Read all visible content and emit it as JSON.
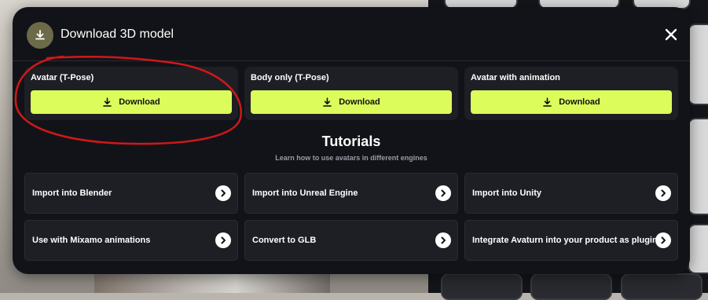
{
  "modal": {
    "title": "Download 3D model",
    "icon": "download-icon",
    "close_icon": "close-icon"
  },
  "downloads": [
    {
      "label": "Avatar (T-Pose)",
      "button": "Download"
    },
    {
      "label": "Body only (T-Pose)",
      "button": "Download"
    },
    {
      "label": "Avatar with animation",
      "button": "Download"
    }
  ],
  "tutorials": {
    "title": "Tutorials",
    "subtitle": "Learn how to use avatars in different engines",
    "items": [
      {
        "label": "Import into Blender"
      },
      {
        "label": "Import into Unreal Engine"
      },
      {
        "label": "Import into Unity"
      },
      {
        "label": "Use with Mixamo animations"
      },
      {
        "label": "Convert to GLB"
      },
      {
        "label": "Integrate Avaturn into your product as plugin"
      }
    ]
  },
  "colors": {
    "accent": "#dcfc5c",
    "modal_bg": "#121318",
    "card_bg": "#1e1f25",
    "annotation": "#d01818"
  }
}
